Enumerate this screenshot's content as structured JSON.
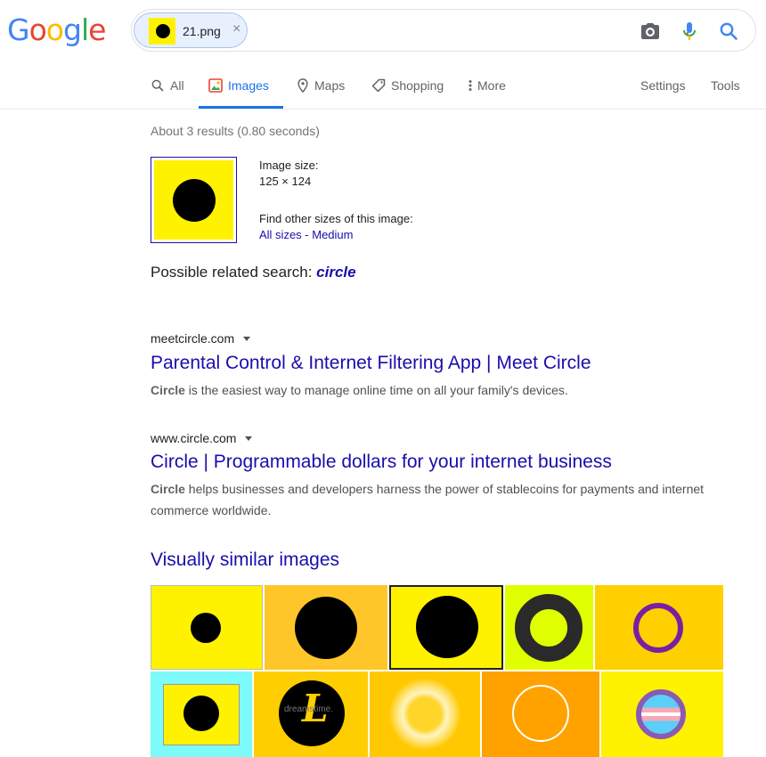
{
  "logo": {
    "letters": [
      "G",
      "o",
      "o",
      "g",
      "l",
      "e"
    ],
    "colors": [
      "#4285f4",
      "#ea4335",
      "#fbbc05",
      "#4285f4",
      "#34a853",
      "#ea4335"
    ]
  },
  "search": {
    "chip_filename": "21.png",
    "clear_symbol": "×"
  },
  "tabs": [
    {
      "label": "All",
      "icon": "search-icon"
    },
    {
      "label": "Images",
      "icon": "image-icon",
      "active": true
    },
    {
      "label": "Maps",
      "icon": "map-pin-icon"
    },
    {
      "label": "Shopping",
      "icon": "tag-icon"
    },
    {
      "label": "More",
      "icon": "more-vertical-icon"
    }
  ],
  "tools": {
    "settings": "Settings",
    "tools": "Tools"
  },
  "stats": "About 3 results (0.80 seconds)",
  "image_info": {
    "size_label": "Image size:",
    "size_value": "125 × 124",
    "find_label": "Find other sizes of this image:",
    "all_sizes": "All sizes",
    "separator": " - ",
    "medium": "Medium"
  },
  "related": {
    "prefix": "Possible related search: ",
    "query": "circle"
  },
  "results": [
    {
      "site": "meetcircle.com",
      "title": "Parental Control & Internet Filtering App | Meet Circle",
      "snippet_bold": "Circle",
      "snippet_rest": " is the easiest way to manage online time on all your family's devices."
    },
    {
      "site": "www.circle.com",
      "title": "Circle | Programmable dollars for your internet business",
      "snippet_bold": "Circle",
      "snippet_rest": " helps businesses and developers harness the power of stablecoins for payments and internet commerce worldwide."
    }
  ],
  "similar": {
    "heading": "Visually similar images",
    "thumb_colors": [
      "#fff200",
      "#ffc629",
      "#fff200",
      "#e0ff00",
      "#ffd000",
      "#fff200",
      "#ffce00",
      "#ffc800",
      "#ffa200",
      "#fff200"
    ],
    "watermark": "dreamstime."
  }
}
